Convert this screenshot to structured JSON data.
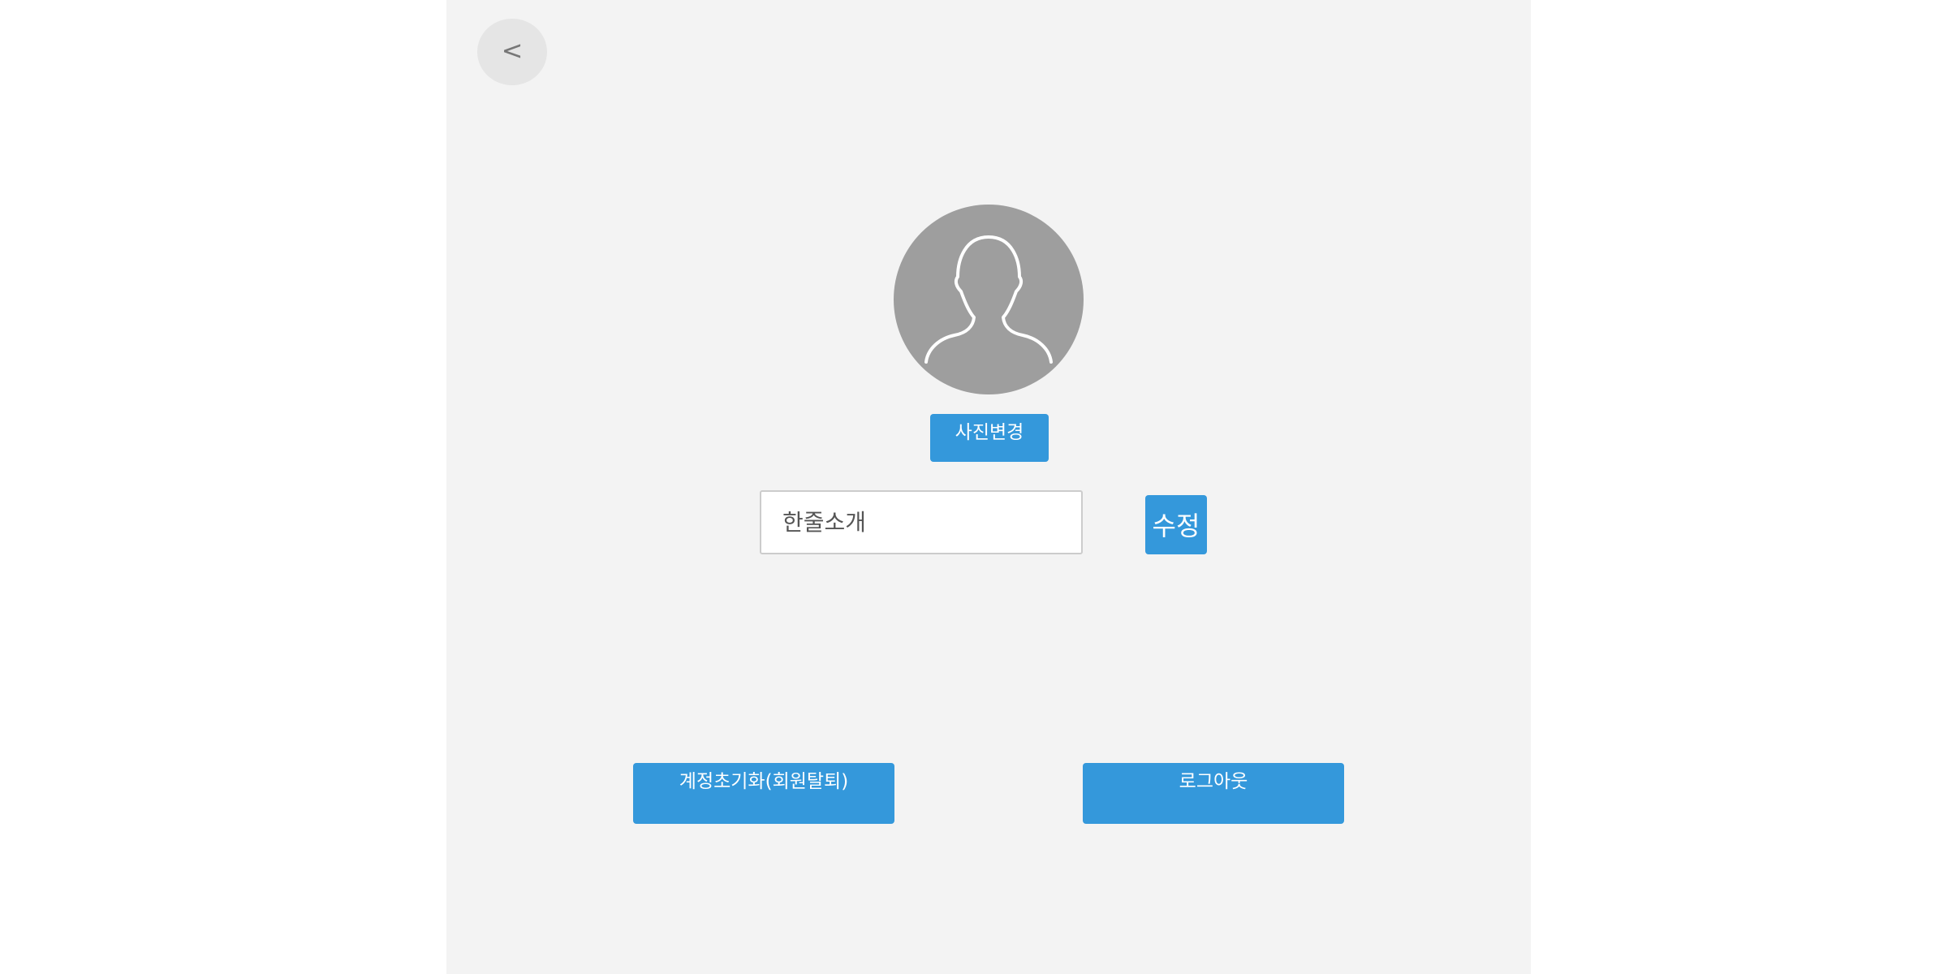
{
  "header": {
    "back_label": "<"
  },
  "profile": {
    "avatar_icon": "person-silhouette-icon",
    "change_photo_label": "사진변경",
    "intro_placeholder": "한줄소개",
    "intro_value": "",
    "edit_label": "수정"
  },
  "actions": {
    "reset_label": "계정초기화(회원탈퇴)",
    "logout_label": "로그아웃"
  },
  "colors": {
    "accent": "#3498db",
    "panel_background": "#f3f3f3",
    "avatar_background": "#9e9e9e"
  }
}
